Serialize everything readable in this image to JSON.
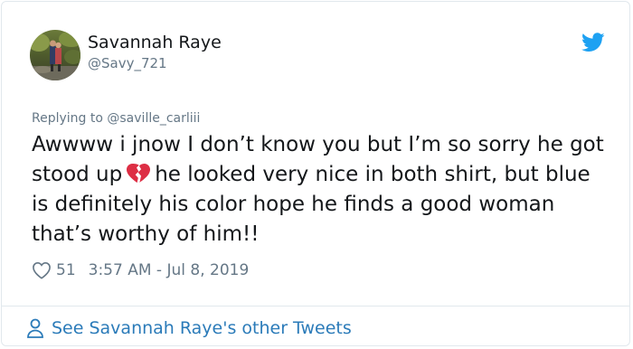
{
  "tweet": {
    "author_name": "Savannah Raye",
    "author_handle": "@Savy_721",
    "replying_prefix": "Replying to ",
    "replying_to": "@saville_carliii",
    "text_before_emoji": "Awwww i jnow I don’t know you but I’m so sorry he got stood up",
    "emoji": "broken-heart-icon",
    "text_after_emoji": "he looked very nice in both shirt, but blue is definitely his color hope he finds a good woman that’s worthy of him!!",
    "likes": "51",
    "timestamp": "3:57 AM - Jul 8, 2019"
  },
  "footer": {
    "link_label": "See Savannah Raye's other Tweets"
  },
  "colors": {
    "twitter_blue": "#1da1f2",
    "link_blue": "#2b7bb9",
    "muted_text": "#657786",
    "border": "#e1e8ed",
    "broken_heart_red": "#dd2e44"
  }
}
